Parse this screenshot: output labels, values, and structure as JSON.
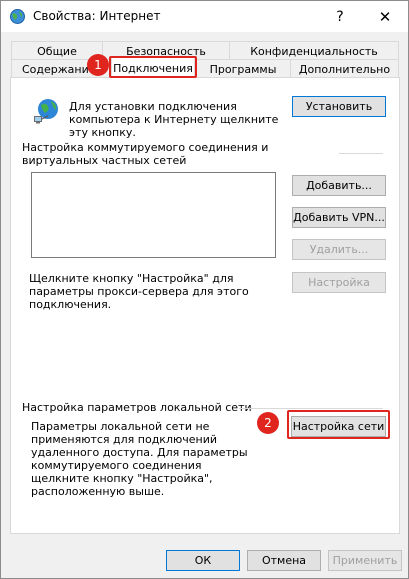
{
  "window": {
    "title": "Свойства: Интернет",
    "help_glyph": "?",
    "close_glyph": "✕"
  },
  "tabs": {
    "row1": [
      "Общие",
      "Безопасность",
      "Конфиденциальность"
    ],
    "row2": [
      "Содержание",
      "Подключения",
      "Программы",
      "Дополнительно"
    ],
    "active": "Подключения"
  },
  "badges": [
    "1",
    "2"
  ],
  "setup": {
    "text": "Для установки подключения компьютера к Интернету щелкните эту кнопку.",
    "button": "Установить"
  },
  "dialup": {
    "heading": "Настройка коммутируемого соединения и виртуальных частных сетей",
    "buttons": {
      "add": "Добавить...",
      "add_vpn": "Добавить VPN...",
      "remove": "Удалить...",
      "settings": "Настройка"
    },
    "proxy_text": "Щелкните кнопку \"Настройка\" для параметры прокси-сервера для этого подключения."
  },
  "lan": {
    "heading": "Настройка параметров локальной сети",
    "text": "Параметры локальной сети не применяются для подключений удаленного доступа. Для параметры коммутируемого соединения щелкните кнопку \"Настройка\", расположенную выше.",
    "button": "Настройка сети"
  },
  "footer": {
    "ok": "ОК",
    "cancel": "Отмена",
    "apply": "Применить"
  },
  "colors": {
    "highlight": "#e0251f",
    "primary_border": "#0078d7"
  }
}
